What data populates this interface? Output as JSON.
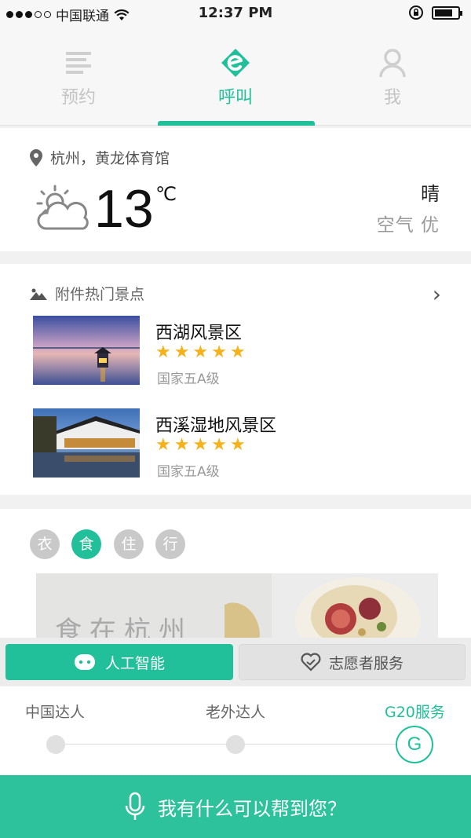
{
  "status_bar": {
    "carrier": "中国联通",
    "time": "12:37 PM"
  },
  "tabs": [
    {
      "label": "预约",
      "icon": "menu-lines-icon"
    },
    {
      "label": "呼叫",
      "icon": "e-logo-icon"
    },
    {
      "label": "我",
      "icon": "person-icon"
    }
  ],
  "weather": {
    "location": "杭州，黄龙体育馆",
    "temperature": "13",
    "unit": "℃",
    "condition": "晴",
    "air_quality": "空气 优"
  },
  "attractions": {
    "heading": "附件热门景点",
    "items": [
      {
        "name": "西湖风景区",
        "rating": 5,
        "grade": "国家五A级"
      },
      {
        "name": "西溪湿地风景区",
        "rating": 5,
        "grade": "国家五A级"
      }
    ]
  },
  "categories": [
    "衣",
    "食",
    "住",
    "行"
  ],
  "food_banner": {
    "text": "食在杭州"
  },
  "service_buttons": {
    "ai": "人工智能",
    "volunteer": "志愿者服务"
  },
  "helper_options": [
    "中国达人",
    "老外达人",
    "G20服务"
  ],
  "helper_knob_letter": "G",
  "voice_bar": {
    "prompt": "我有什么可以帮到您？"
  },
  "colors": {
    "accent": "#22c09a",
    "star": "#f5b21a"
  }
}
